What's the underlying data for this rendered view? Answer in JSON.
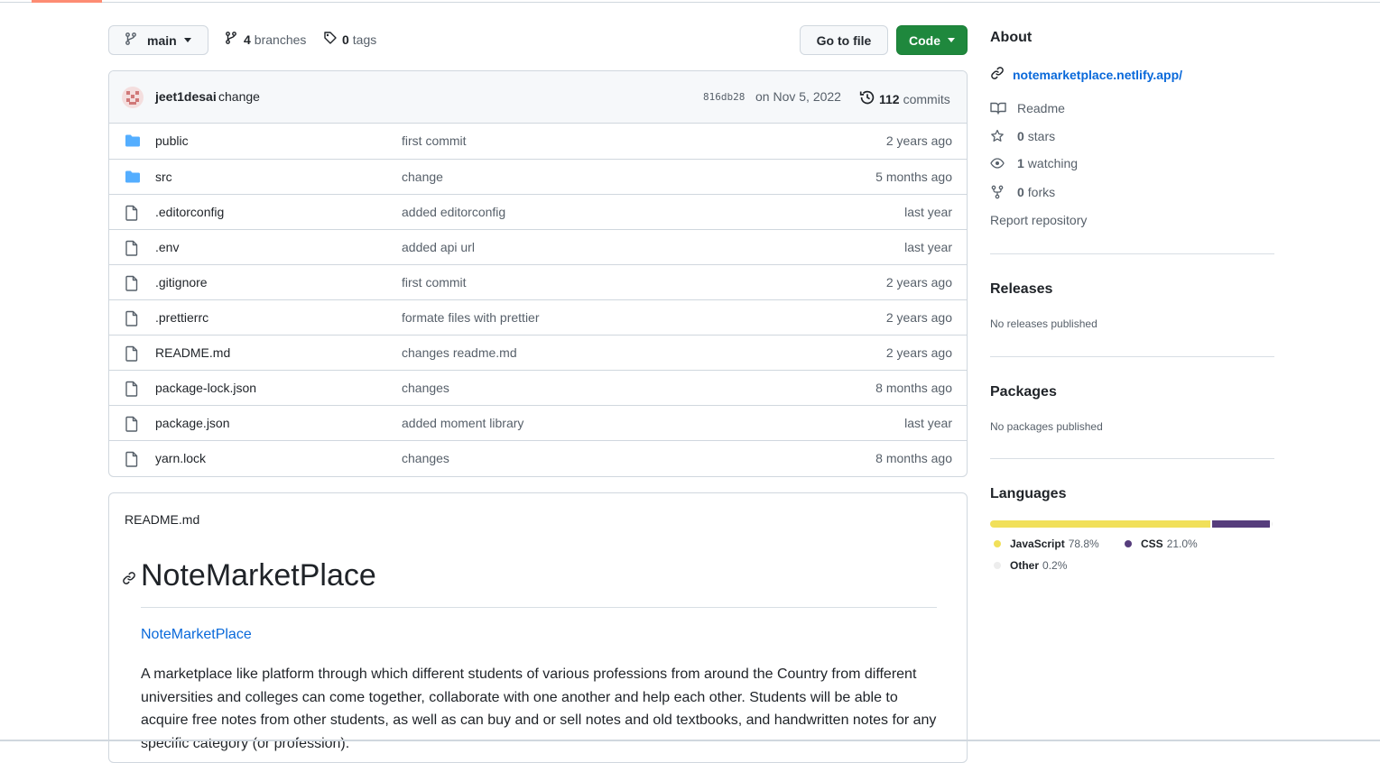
{
  "toolbar": {
    "branch_name": "main",
    "branches_count": "4",
    "branches_label": "branches",
    "tags_count": "0",
    "tags_label": "tags",
    "goto_label": "Go to file",
    "code_label": "Code"
  },
  "latest_commit": {
    "author": "jeet1desai",
    "message": "change",
    "sha": "816db28",
    "date": "on Nov 5, 2022",
    "count": "112",
    "count_label": "commits"
  },
  "files": [
    {
      "name": "public",
      "type": "dir",
      "message": "first commit",
      "age": "2 years ago"
    },
    {
      "name": "src",
      "type": "dir",
      "message": "change",
      "age": "5 months ago"
    },
    {
      "name": ".editorconfig",
      "type": "file",
      "message": "added editorconfig",
      "age": "last year"
    },
    {
      "name": ".env",
      "type": "file",
      "message": "added api url",
      "age": "last year"
    },
    {
      "name": ".gitignore",
      "type": "file",
      "message": "first commit",
      "age": "2 years ago"
    },
    {
      "name": ".prettierrc",
      "type": "file",
      "message": "formate files with prettier",
      "age": "2 years ago"
    },
    {
      "name": "README.md",
      "type": "file",
      "message": "changes readme.md",
      "age": "2 years ago"
    },
    {
      "name": "package-lock.json",
      "type": "file",
      "message": "changes",
      "age": "8 months ago"
    },
    {
      "name": "package.json",
      "type": "file",
      "message": "added moment library",
      "age": "last year"
    },
    {
      "name": "yarn.lock",
      "type": "file",
      "message": "changes",
      "age": "8 months ago"
    }
  ],
  "readme": {
    "file_title": "README.md",
    "heading": "NoteMarketPlace",
    "link_text": "NoteMarketPlace",
    "paragraph": "A marketplace like platform through which different students of various professions from around the Country from different universities and colleges can come together, collaborate with one another and help each other. Students will be able to acquire free notes from other students, as well as can buy and or sell notes and old textbooks, and handwritten notes for any specific category (or profession)."
  },
  "about": {
    "title": "About",
    "website": "notemarketplace.netlify.app/",
    "readme_label": "Readme",
    "stars_count": "0",
    "stars_label": "stars",
    "watching_count": "1",
    "watching_label": "watching",
    "forks_count": "0",
    "forks_label": "forks",
    "report_label": "Report repository"
  },
  "releases": {
    "title": "Releases",
    "empty": "No releases published"
  },
  "packages": {
    "title": "Packages",
    "empty": "No packages published"
  },
  "languages": {
    "title": "Languages",
    "items": [
      {
        "name": "JavaScript",
        "percent": "78.8%",
        "value": 78.8,
        "color": "#f1e05a"
      },
      {
        "name": "CSS",
        "percent": "21.0%",
        "value": 21.0,
        "color": "#563d7c"
      },
      {
        "name": "Other",
        "percent": "0.2%",
        "value": 0.2,
        "color": "#ededed"
      }
    ]
  },
  "colors": {
    "accent": "#fd8c73",
    "primary_button": "#1f883d",
    "link": "#0969da",
    "folder": "#54aeff"
  }
}
